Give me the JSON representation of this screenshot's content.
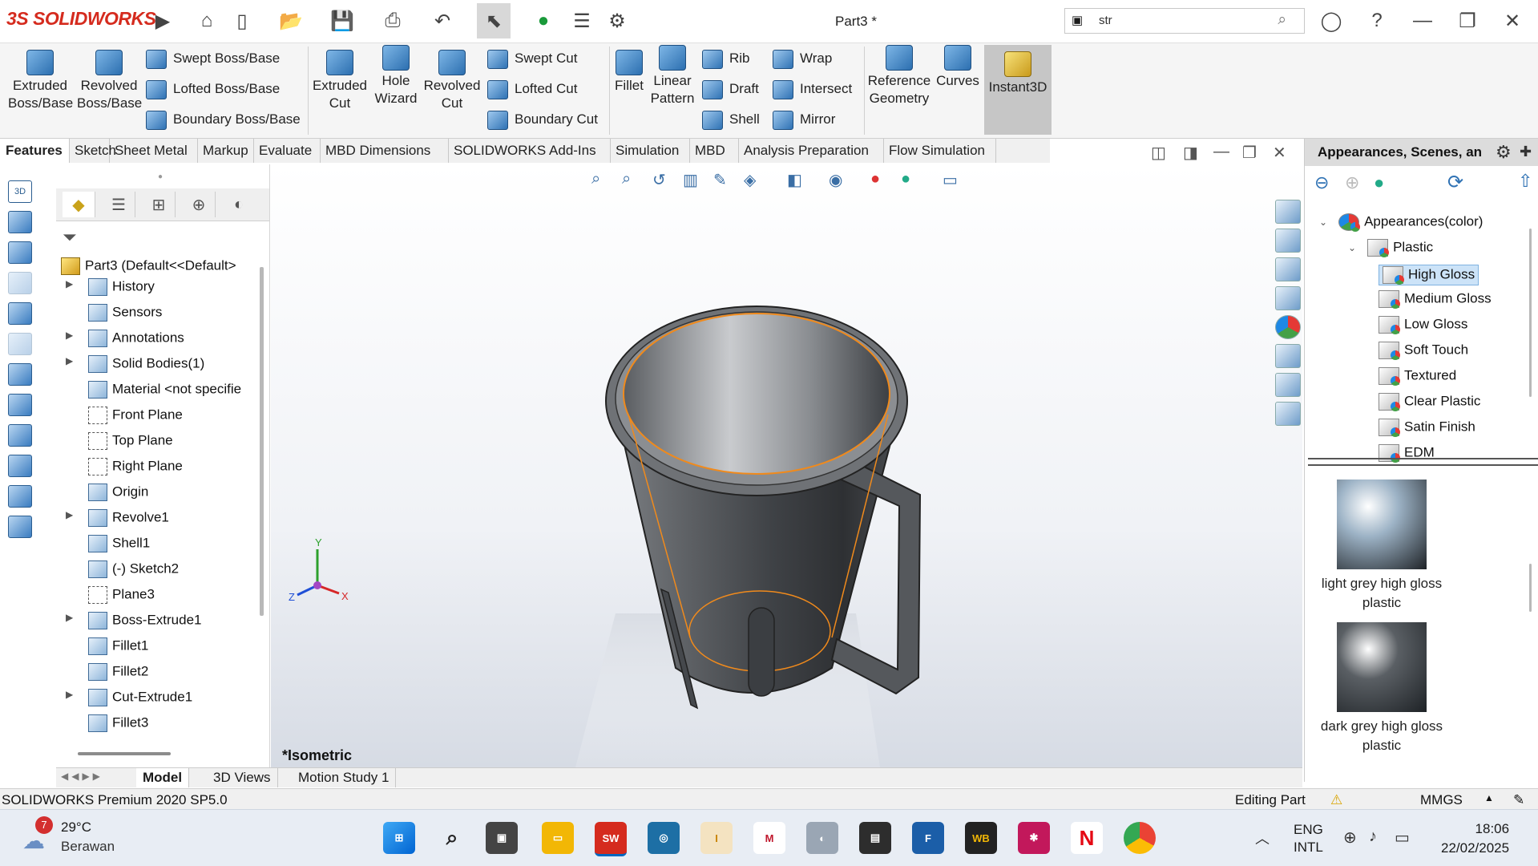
{
  "titlebar": {
    "logo": "3S SOLIDWORKS",
    "document_title": "Part3 *",
    "search_value": "str"
  },
  "command_manager": {
    "extruded_boss": "Extruded Boss/Base",
    "revolved_boss": "Revolved Boss/Base",
    "swept_boss": "Swept Boss/Base",
    "lofted_boss": "Lofted Boss/Base",
    "boundary_boss": "Boundary Boss/Base",
    "extruded_cut": "Extruded Cut",
    "hole_wizard": "Hole Wizard",
    "revolved_cut": "Revolved Cut",
    "swept_cut": "Swept Cut",
    "lofted_cut": "Lofted Cut",
    "boundary_cut": "Boundary Cut",
    "fillet": "Fillet",
    "linear_pattern": "Linear Pattern",
    "rib": "Rib",
    "draft": "Draft",
    "shell": "Shell",
    "wrap": "Wrap",
    "intersect": "Intersect",
    "mirror": "Mirror",
    "reference_geometry": "Reference Geometry",
    "curves": "Curves",
    "instant3d": "Instant3D"
  },
  "tabs": [
    "Features",
    "Sketch",
    "Sheet Metal",
    "Markup",
    "Evaluate",
    "MBD Dimensions",
    "SOLIDWORKS Add-Ins",
    "Simulation",
    "MBD",
    "Analysis Preparation",
    "Flow Simulation"
  ],
  "feature_tree": {
    "root": "Part3  (Default<<Default>",
    "nodes": [
      "History",
      "Sensors",
      "Annotations",
      "Solid Bodies(1)",
      "Material <not specifie",
      "Front Plane",
      "Top Plane",
      "Right Plane",
      "Origin",
      "Revolve1",
      "Shell1",
      "(-) Sketch2",
      "Plane3",
      "Boss-Extrude1",
      "Fillet1",
      "Fillet2",
      "Cut-Extrude1",
      "Fillet3"
    ]
  },
  "viewport": {
    "view_label": "*Isometric",
    "triad": {
      "x": "X",
      "y": "Y",
      "z": "Z"
    }
  },
  "task_pane": {
    "title": "Appearances, Scenes, an",
    "tree": {
      "root": "Appearances(color)",
      "folder": "Plastic",
      "items": [
        "High Gloss",
        "Medium Gloss",
        "Low Gloss",
        "Soft Touch",
        "Textured",
        "Clear Plastic",
        "Satin Finish",
        "EDM"
      ],
      "selected": "High Gloss"
    },
    "swatches": [
      {
        "label_line1": "light grey high gloss",
        "label_line2": "plastic",
        "color": "#9db3c6"
      },
      {
        "label_line1": "dark grey high gloss",
        "label_line2": "plastic",
        "color": "#5a5f64"
      }
    ]
  },
  "model_tabs": [
    "Model",
    "3D Views",
    "Motion Study 1"
  ],
  "status_bar": {
    "product": "SOLIDWORKS Premium 2020 SP5.0",
    "mode": "Editing Part",
    "units": "MMGS"
  },
  "taskbar": {
    "weather_temp": "29°C",
    "weather_desc": "Berawan",
    "weather_badge": "7",
    "lang_line1": "ENG",
    "lang_line2": "INTL",
    "time": "18:06",
    "date": "22/02/2025"
  },
  "colors": {
    "brand_red": "#d52b1e",
    "model_grey": "#6b6e72",
    "selection_orange": "#f08a1c",
    "accent_blue": "#2f72b4"
  }
}
